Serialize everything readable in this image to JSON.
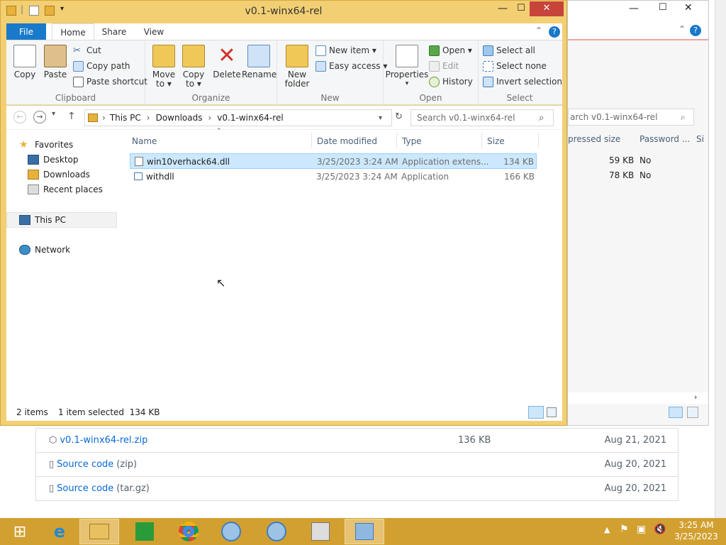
{
  "window": {
    "title": "v0.1-winx64-rel"
  },
  "ribbon": {
    "tabs": [
      "File",
      "Home",
      "Share",
      "View"
    ],
    "clipboard": {
      "copy": "Copy",
      "paste": "Paste",
      "cut": "Cut",
      "copy_path": "Copy path",
      "paste_shortcut": "Paste shortcut",
      "label": "Clipboard"
    },
    "organize": {
      "move_to": "Move\nto ▾",
      "copy_to": "Copy\nto ▾",
      "delete": "Delete",
      "rename": "Rename",
      "label": "Organize"
    },
    "new": {
      "new_folder": "New\nfolder",
      "new_item": "New item ▾",
      "easy_access": "Easy access ▾",
      "label": "New"
    },
    "open": {
      "properties": "Properties",
      "open": "Open ▾",
      "edit": "Edit",
      "history": "History",
      "label": "Open"
    },
    "select": {
      "select_all": "Select all",
      "select_none": "Select none",
      "invert": "Invert selection",
      "label": "Select"
    }
  },
  "address": {
    "crumbs": [
      "This PC",
      "Downloads",
      "v0.1-winx64-rel"
    ],
    "search_placeholder": "Search v0.1-winx64-rel"
  },
  "nav": {
    "favorites": "Favorites",
    "desktop": "Desktop",
    "downloads": "Downloads",
    "recent": "Recent places",
    "thispc": "This PC",
    "network": "Network"
  },
  "columns": {
    "name": "Name",
    "date": "Date modified",
    "type": "Type",
    "size": "Size"
  },
  "files": [
    {
      "name": "win10verhack64.dll",
      "date": "3/25/2023 3:24 AM",
      "type": "Application extens...",
      "size": "134 KB"
    },
    {
      "name": "withdll",
      "date": "3/25/2023 3:24 AM",
      "type": "Application",
      "size": "166 KB"
    }
  ],
  "status": {
    "count": "2 items",
    "selected": "1 item selected  134 KB"
  },
  "back_window": {
    "search_placeholder": "arch v0.1-winx64-rel",
    "columns": {
      "compressed": "pressed size",
      "password": "Password ...",
      "si": "Si"
    },
    "rows": [
      {
        "csize": "59 KB",
        "pw": "No"
      },
      {
        "csize": "78 KB",
        "pw": "No"
      }
    ]
  },
  "downloads": [
    {
      "name": "v0.1-winx64-rel.zip",
      "sub": "",
      "size": "136 KB",
      "date": "Aug 21, 2021"
    },
    {
      "name": "Source code",
      "sub": "(zip)",
      "size": "",
      "date": "Aug 20, 2021"
    },
    {
      "name": "Source code",
      "sub": "(tar.gz)",
      "size": "",
      "date": "Aug 20, 2021"
    }
  ],
  "clock": {
    "time": "3:25 AM",
    "date": "3/25/2023"
  },
  "colors": {
    "accent": "#1979ca",
    "taskbar": "#d2a031",
    "window_frame": "#f2cf73",
    "selection": "#cce8ff"
  }
}
